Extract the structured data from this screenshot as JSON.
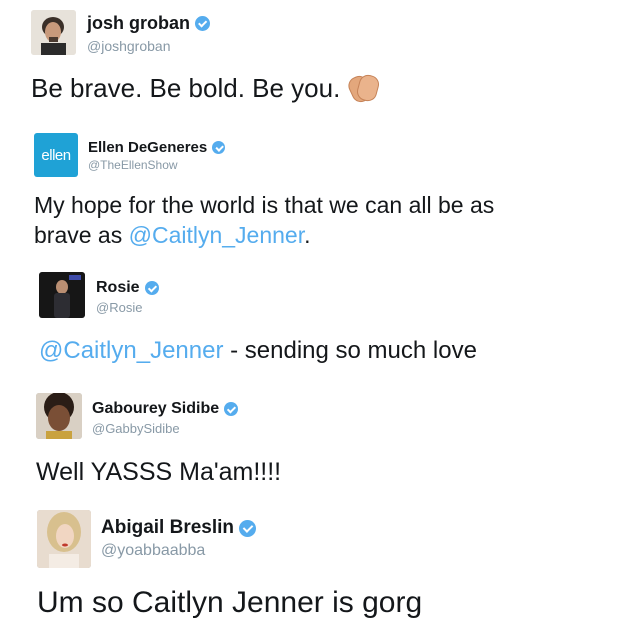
{
  "tweets": [
    {
      "name": "josh groban",
      "handle": "@joshgroban",
      "text": "Be brave. Be bold. Be you.",
      "emoji": "clapping-hands-emoji"
    },
    {
      "name": "Ellen DeGeneres",
      "handle": "@TheEllenShow",
      "avatar_text": "ellen",
      "text_line1": "My hope for the world is that we can all be as",
      "text_line2_prefix": "brave as ",
      "text_line2_mention": "@Caitlyn_Jenner",
      "text_line2_suffix": "."
    },
    {
      "name": "Rosie",
      "handle": "@Rosie",
      "text_mention": "@Caitlyn_Jenner",
      "text_suffix": " - sending so much love"
    },
    {
      "name": "Gabourey Sidibe",
      "handle": "@GabbySidibe",
      "text": "Well YASSS Ma'am!!!!"
    },
    {
      "name": "Abigail Breslin",
      "handle": "@yoabbaabba",
      "text": "Um so Caitlyn Jenner is gorg"
    }
  ],
  "colors": {
    "link": "#55acee",
    "verified": "#55acee",
    "handle": "#8899a6",
    "text": "#14171a"
  }
}
